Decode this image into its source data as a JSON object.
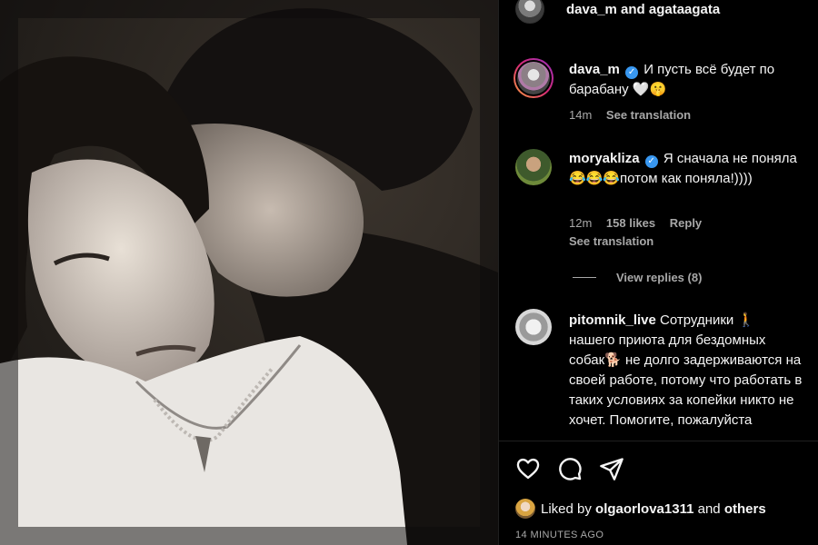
{
  "post": {
    "header_title": "dava_m and agataagata"
  },
  "comments": [
    {
      "username": "dava_m",
      "verified": true,
      "text": "И пусть всё будет по барабану 🤍🤫",
      "time": "14m",
      "see_translation": "See translation"
    },
    {
      "username": "moryakliza",
      "verified": true,
      "text": "Я сначала не поняла 😂😂😂потом как поняла!))))",
      "time": "12m",
      "likes": "158 likes",
      "reply": "Reply",
      "see_translation": "See translation",
      "view_replies": "View replies (8)"
    },
    {
      "username": "pitomnik_live",
      "verified": false,
      "text": "Сотрудники 🚶 нашего приюта для бездомных собак🐕 не долго задерживаются на своей работе, потому что работать в таких условиях за копейки никто не хочет. Помогите, пожалуйста"
    }
  ],
  "likes": {
    "prefix": "Liked by",
    "user": "olgaorlova1311",
    "and": "and",
    "others": "others"
  },
  "timestamp": "14 MINUTES AGO",
  "icons": [
    "heart-icon",
    "comment-icon",
    "share-icon",
    "verified-icon"
  ]
}
